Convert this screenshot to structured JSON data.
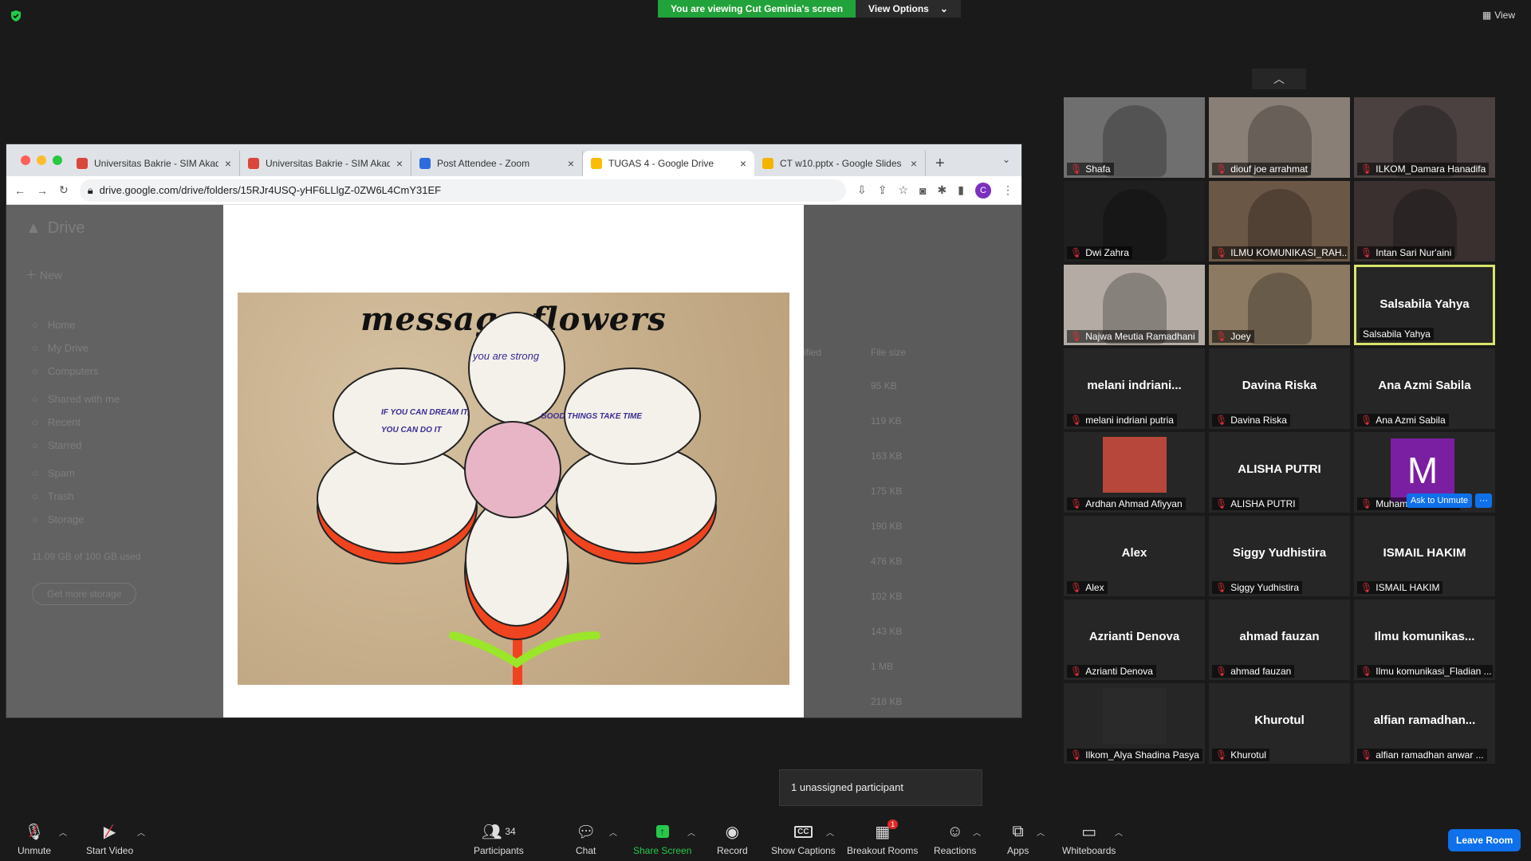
{
  "banner": {
    "viewing": "You are viewing Cut Geminia's screen",
    "options": "View Options"
  },
  "view_button": "View",
  "browser": {
    "tabs": [
      {
        "title": "Universitas Bakrie - SIM Akade",
        "active": false,
        "color": "#d9463b"
      },
      {
        "title": "Universitas Bakrie - SIM Akade",
        "active": false,
        "color": "#d9463b"
      },
      {
        "title": "Post Attendee - Zoom",
        "active": false,
        "color": "#2d6cdf"
      },
      {
        "title": "TUGAS 4 - Google Drive",
        "active": true,
        "color": "#fbbc04"
      },
      {
        "title": "CT w10.pptx - Google Slides",
        "active": false,
        "color": "#f4b400"
      }
    ],
    "url": "drive.google.com/drive/folders/15RJr4USQ-yHF6LLlgZ-0ZW6L4CmY31EF",
    "profile_initial": "C"
  },
  "drive": {
    "logo": "Drive",
    "new": "New",
    "nav": [
      "Home",
      "My Drive",
      "Computers",
      "Shared with me",
      "Recent",
      "Starred",
      "Spam",
      "Trash",
      "Storage"
    ],
    "storage_text": "11.09 GB of 100 GB used",
    "get_more": "Get more storage",
    "file_size_header": "File size",
    "modified_header": "ified",
    "sizes": [
      "95 KB",
      "119 KB",
      "163 KB",
      "175 KB",
      "190 KB",
      "476 KB",
      "102 KB",
      "143 KB",
      "1 MB",
      "218 KB"
    ]
  },
  "image": {
    "title": "message flowers",
    "petals": [
      "you are strong",
      "IF YOU CAN DREAM IT, YOU CAN DO IT",
      "GOOD THINGS TAKE TIME"
    ]
  },
  "participants": [
    {
      "name": "Shafa",
      "type": "video",
      "bg": "#6f6f6f"
    },
    {
      "name": "diouf joe arrahmat",
      "type": "video",
      "bg": "#8a7f76"
    },
    {
      "name": "ILKOM_Damara Hanadifa",
      "type": "video",
      "bg": "#4a4140"
    },
    {
      "name": "Dwi Zahra",
      "type": "video",
      "bg": "#1f1f1f"
    },
    {
      "name": "ILMU KOMUNIKASI_RAH...",
      "type": "video",
      "bg": "#6b5746"
    },
    {
      "name": "Intan Sari Nur'aini",
      "type": "video",
      "bg": "#3a3030"
    },
    {
      "name": "Najwa Meutia Ramadhani",
      "type": "video",
      "bg": "#b4aca4"
    },
    {
      "name": "Joey",
      "type": "video",
      "bg": "#8c7a63"
    },
    {
      "name": "Salsabila Yahya",
      "type": "name",
      "display": "Salsabila Yahya",
      "speaking": true,
      "muted": false
    },
    {
      "name": "melani indriani putria",
      "type": "name",
      "display": "melani  indriani..."
    },
    {
      "name": "Davina Riska",
      "type": "name",
      "display": "Davina Riska"
    },
    {
      "name": "Ana Azmi Sabila",
      "type": "name",
      "display": "Ana Azmi Sabila"
    },
    {
      "name": "Ardhan Ahmad Afiyyan",
      "type": "pic",
      "bg": "#b6473a"
    },
    {
      "name": "ALISHA PUTRI",
      "type": "name",
      "display": "ALISHA PUTRI"
    },
    {
      "name": "Muhammad Hamdi",
      "type": "avatar",
      "display": "M"
    },
    {
      "name": "Alex",
      "type": "name",
      "display": "Alex"
    },
    {
      "name": "Siggy Yudhistira",
      "type": "name",
      "display": "Siggy Yudhistira"
    },
    {
      "name": "ISMAIL HAKIM",
      "type": "name",
      "display": "ISMAIL HAKIM"
    },
    {
      "name": "Azrianti Denova",
      "type": "name",
      "display": "Azrianti Denova"
    },
    {
      "name": "ahmad fauzan",
      "type": "name",
      "display": "ahmad fauzan"
    },
    {
      "name": "Ilmu komunikasi_Fladian ...",
      "type": "name",
      "display": "Ilmu  komunikas..."
    },
    {
      "name": "Ilkom_Alya Shadina Pasya",
      "type": "pic",
      "bg": "#2a2a2a"
    },
    {
      "name": "Khurotul",
      "type": "name",
      "display": "Khurotul"
    },
    {
      "name": "alfian ramadhan anwar ...",
      "type": "name",
      "display": "alfian  ramadhan..."
    }
  ],
  "ask_to_unmute": "Ask to Unmute",
  "more": "···",
  "unassigned": "1 unassigned participant",
  "toolbar": {
    "unmute": "Unmute",
    "start_video": "Start Video",
    "participants": "Participants",
    "participants_count": "34",
    "chat": "Chat",
    "share_screen": "Share Screen",
    "record": "Record",
    "show_captions": "Show Captions",
    "breakout_rooms": "Breakout Rooms",
    "breakout_badge": "1",
    "reactions": "Reactions",
    "apps": "Apps",
    "whiteboards": "Whiteboards",
    "leave": "Leave Room"
  },
  "colors": {
    "accent": "#0e71eb",
    "share_green": "#27c84a",
    "banner_green": "#22a23a",
    "speaker_border": "#d9e46b",
    "muted_red": "#e0303a"
  }
}
